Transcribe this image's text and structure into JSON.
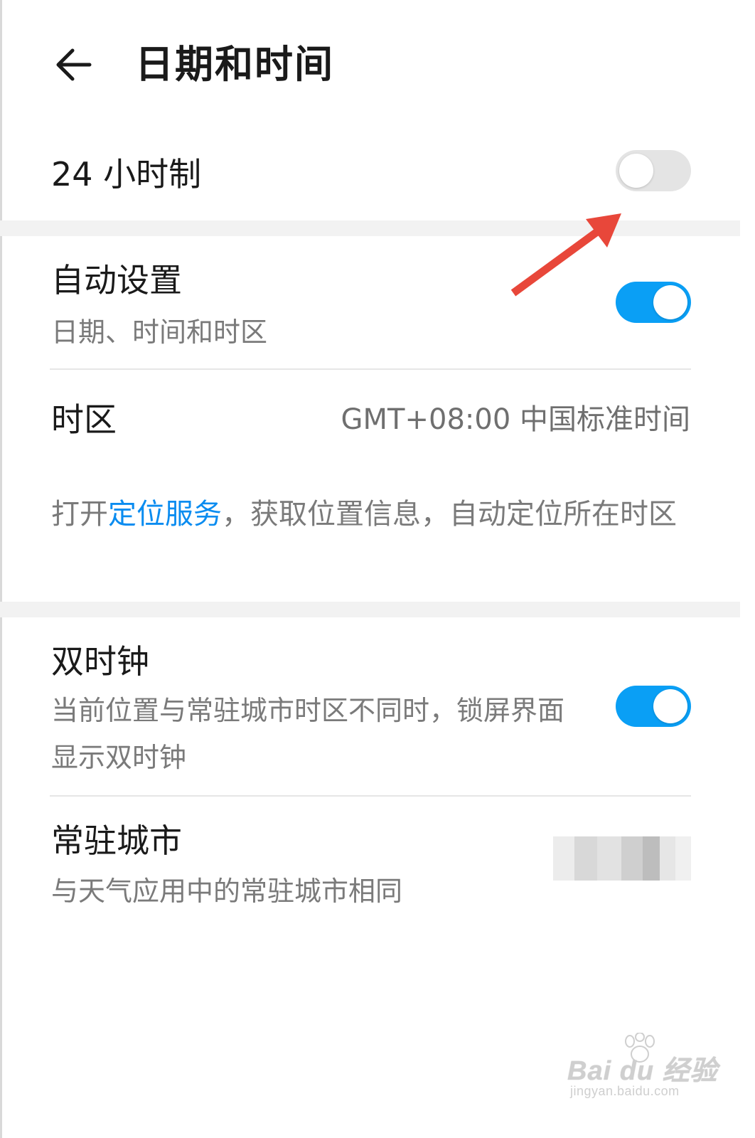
{
  "header": {
    "title": "日期和时间"
  },
  "hour24": {
    "label": "24 小时制",
    "enabled": false
  },
  "auto_set": {
    "label": "自动设置",
    "sublabel": "日期、时间和时区",
    "enabled": true
  },
  "timezone": {
    "label": "时区",
    "value": "GMT+08:00 中国标准时间"
  },
  "location_hint": {
    "prefix": "打开",
    "link": "定位服务",
    "suffix": "，获取位置信息，自动定位所在时区"
  },
  "dual_clock": {
    "label": "双时钟",
    "sublabel": "当前位置与常驻城市时区不同时，锁屏界面显示双时钟",
    "enabled": true
  },
  "home_city": {
    "label": "常驻城市",
    "sublabel": "与天气应用中的常驻城市相同"
  },
  "watermark": {
    "main": "Bai du 经验",
    "sub": "jingyan.baidu.com"
  },
  "colors": {
    "accent": "#0a9ff5",
    "link": "#0a8cf0",
    "annotation_arrow": "#e8473a",
    "toggle_off": "#e4e4e4"
  }
}
